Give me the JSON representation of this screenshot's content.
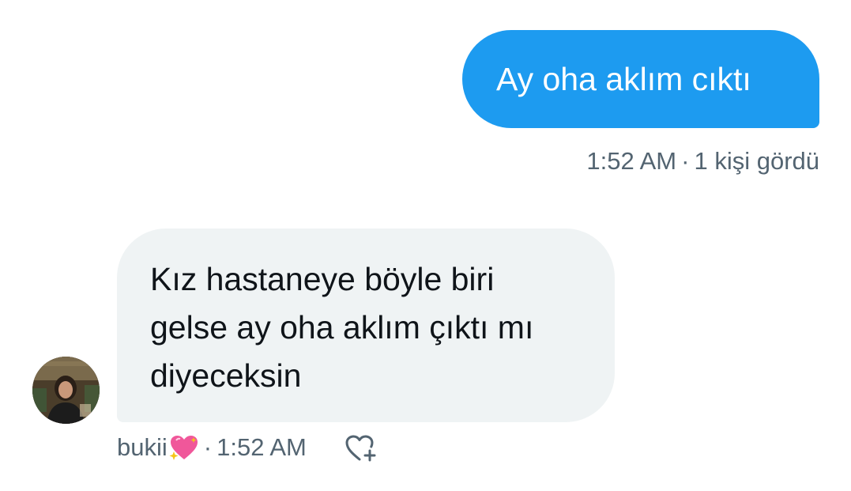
{
  "conversation": {
    "sent_message": {
      "text": "Ay oha aklım cıktı",
      "time": "1:52 AM",
      "separator": "·",
      "seen_status": "1 kişi gördü"
    },
    "received_message": {
      "lines": [
        "Kız hastaneye böyle biri",
        "gelse ay oha aklım çıktı mı",
        "diyeceksin"
      ],
      "sender_name": "bukii",
      "sender_emoji": "sparkling-heart-icon",
      "separator": "·",
      "time": "1:52 AM",
      "reaction_icon": "add-reaction-heart-icon"
    }
  },
  "colors": {
    "sent_bubble": "#1d9bf0",
    "received_bubble": "#eff3f4",
    "meta_text": "#536471",
    "primary_text": "#0f1419"
  }
}
